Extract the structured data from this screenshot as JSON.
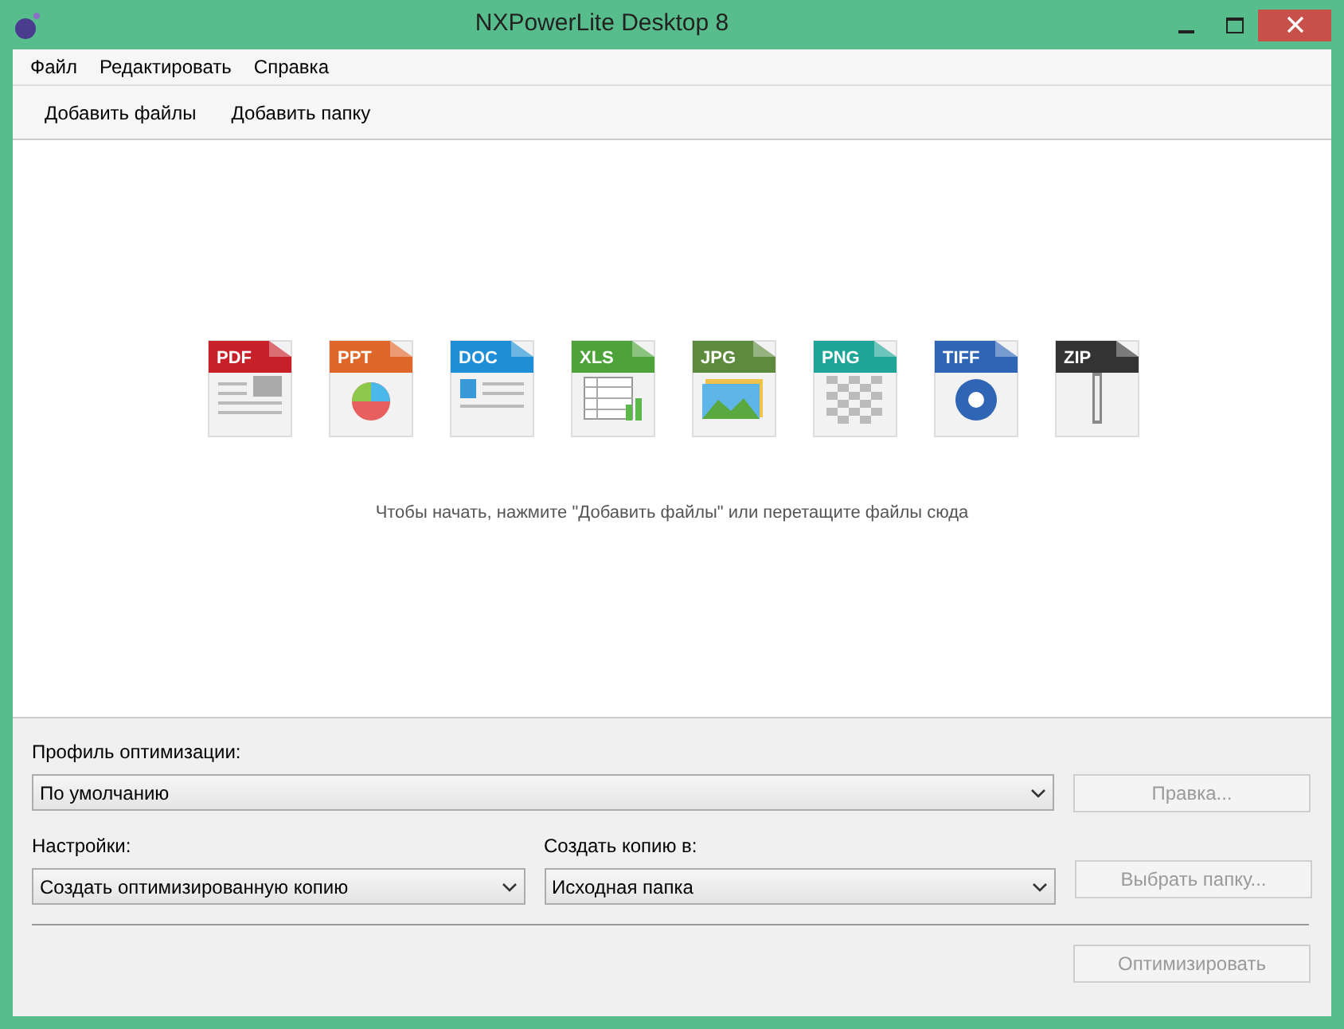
{
  "window": {
    "title": "NXPowerLite Desktop 8"
  },
  "menu": [
    "Файл",
    "Редактировать",
    "Справка"
  ],
  "toolbar": [
    "Добавить файлы",
    "Добавить папку"
  ],
  "file_types": [
    {
      "label": "PDF",
      "color": "#c8202a",
      "kind": "document"
    },
    {
      "label": "PPT",
      "color": "#e0672a",
      "kind": "chart"
    },
    {
      "label": "DOC",
      "color": "#1e8fd6",
      "kind": "text"
    },
    {
      "label": "XLS",
      "color": "#4ea23a",
      "kind": "sheet"
    },
    {
      "label": "JPG",
      "color": "#5d8a3c",
      "kind": "photo"
    },
    {
      "label": "PNG",
      "color": "#1ea597",
      "kind": "checker"
    },
    {
      "label": "TIFF",
      "color": "#2f65b5",
      "kind": "aperture"
    },
    {
      "label": "ZIP",
      "color": "#333333",
      "kind": "zipper"
    }
  ],
  "hint": "Чтобы начать, нажмите \"Добавить файлы\" или перетащите файлы сюда",
  "profile": {
    "label": "Профиль оптимизации:",
    "value": "По умолчанию",
    "button": {
      "label": "Правка...",
      "disabled": true
    }
  },
  "settings": {
    "label": "Настройки:",
    "value": "Создать оптимизированную копию"
  },
  "copy_to": {
    "label": "Создать копию в:",
    "value": "Исходная папка",
    "button": {
      "label": "Выбрать папку...",
      "disabled": true
    }
  },
  "optimize_button": {
    "label": "Оптимизировать",
    "disabled": true
  }
}
